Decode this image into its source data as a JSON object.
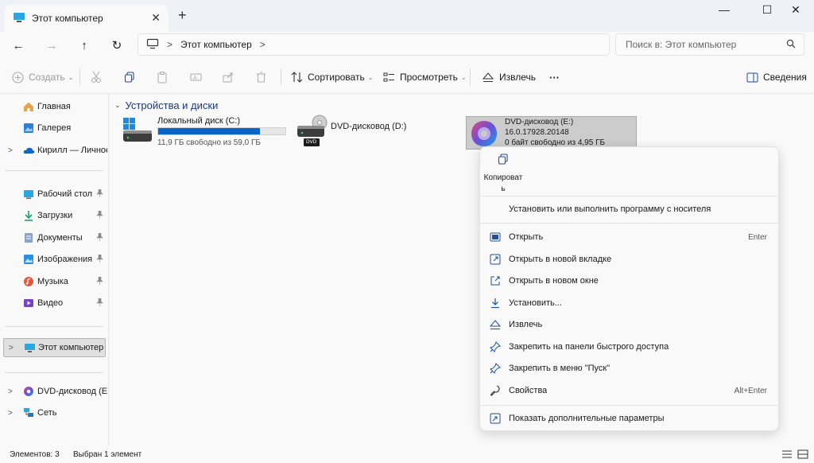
{
  "window": {
    "tab_title": "Этот компьютер",
    "tab_close": "✕",
    "new_tab": "+",
    "minimize": "—",
    "maximize": "☐",
    "close": "✕"
  },
  "nav": {
    "back": "←",
    "forward": "→",
    "up": "↑",
    "refresh": "↻",
    "breadcrumb_sep": ">",
    "breadcrumb": "Этот компьютер",
    "breadcrumb_end": ">",
    "search_placeholder": "Поиск в: Этот компьютер"
  },
  "toolbar": {
    "create": "Создать",
    "sort": "Сортировать",
    "view": "Просмотреть",
    "eject": "Извлечь",
    "more": "···",
    "details": "Сведения",
    "chevron": "⌄"
  },
  "sidebar": {
    "items": [
      {
        "label": "Главная",
        "icon": "home-icon"
      },
      {
        "label": "Галерея",
        "icon": "gallery-icon"
      },
      {
        "label": "Кирилл — Личное",
        "icon": "onedrive-icon",
        "expander": ">"
      },
      {
        "label": "Рабочий стол",
        "icon": "desktop-icon",
        "pin": "📌"
      },
      {
        "label": "Загрузки",
        "icon": "downloads-icon",
        "pin": "📌"
      },
      {
        "label": "Документы",
        "icon": "documents-icon",
        "pin": "📌"
      },
      {
        "label": "Изображения",
        "icon": "pictures-icon",
        "pin": "📌"
      },
      {
        "label": "Музыка",
        "icon": "music-icon",
        "pin": "📌"
      },
      {
        "label": "Видео",
        "icon": "videos-icon",
        "pin": "📌"
      },
      {
        "label": "Этот компьютер",
        "icon": "this-pc-icon",
        "expander": ">"
      },
      {
        "label": "DVD-дисковод (E:)",
        "icon": "dvd-office-icon",
        "expander": ">"
      },
      {
        "label": "Сеть",
        "icon": "network-icon",
        "expander": ">"
      }
    ]
  },
  "content": {
    "group_header": "Устройства и диски",
    "group_chevron": "⌄",
    "drives": [
      {
        "name": "Локальный диск (C:)",
        "detail": "11,9 ГБ свободно из 59,0 ГБ",
        "used_fraction": 0.8,
        "icon": "windows-drive-icon"
      },
      {
        "name": "DVD-дисковод (D:)",
        "detail": "",
        "icon": "dvd-drive-icon",
        "badge": "DVD"
      },
      {
        "name": "DVD-дисковод (E:)",
        "line2": "16.0.17928.20148",
        "detail": "0 байт свободно из 4,95 ГБ",
        "icon": "office-logo-icon"
      }
    ]
  },
  "context_menu": {
    "copy_label": "Копировать",
    "items": [
      {
        "label": "Установить или выполнить программу с носителя",
        "icon": "",
        "shortcut": ""
      },
      {
        "label": "Открыть",
        "icon": "open-icon",
        "shortcut": "Enter"
      },
      {
        "label": "Открыть в новой вкладке",
        "icon": "new-tab-icon",
        "shortcut": ""
      },
      {
        "label": "Открыть в новом окне",
        "icon": "new-window-icon",
        "shortcut": ""
      },
      {
        "label": "Установить...",
        "icon": "install-icon",
        "shortcut": ""
      },
      {
        "label": "Извлечь",
        "icon": "eject-icon",
        "shortcut": ""
      },
      {
        "label": "Закрепить на панели быстрого доступа",
        "icon": "pin-icon",
        "shortcut": ""
      },
      {
        "label": "Закрепить в меню \"Пуск\"",
        "icon": "pin-icon",
        "shortcut": ""
      },
      {
        "label": "Свойства",
        "icon": "properties-icon",
        "shortcut": "Alt+Enter"
      },
      {
        "label": "Показать дополнительные параметры",
        "icon": "more-options-icon",
        "shortcut": ""
      }
    ]
  },
  "status": {
    "count": "Элементов: 3",
    "selected": "Выбран 1 элемент"
  },
  "colors": {
    "accent": "#0a64c8",
    "header_text": "#1e3a7a"
  }
}
